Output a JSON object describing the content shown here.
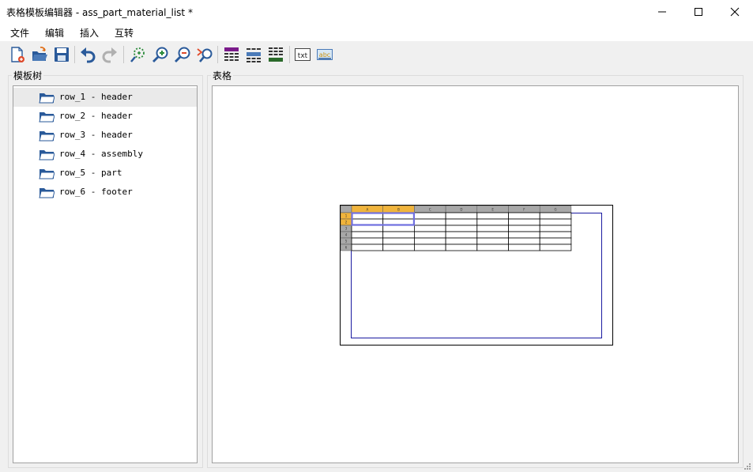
{
  "window": {
    "title": "表格模板编辑器 - ass_part_material_list *",
    "minimize": "—",
    "maximize": "☐",
    "close": "✕"
  },
  "menu": {
    "items": [
      "文件",
      "编辑",
      "插入",
      "互转"
    ]
  },
  "toolbar": {
    "buttons": [
      "new-file-icon",
      "open-folder-icon",
      "save-icon",
      "undo-icon",
      "redo-icon",
      "fit-view-icon",
      "zoom-in-icon",
      "zoom-out-icon",
      "zoom-reset-icon",
      "table-style-1-icon",
      "table-style-2-icon",
      "table-style-3-icon",
      "txt-icon",
      "abc-text-icon"
    ],
    "txt_label": "txt",
    "abc_label": "abc"
  },
  "tree_panel": {
    "title": "模板树",
    "items": [
      {
        "label": "row_1 - header",
        "selected": true
      },
      {
        "label": "row_2 - header",
        "selected": false
      },
      {
        "label": "row_3 - header",
        "selected": false
      },
      {
        "label": "row_4 - assembly",
        "selected": false
      },
      {
        "label": "row_5 - part",
        "selected": false
      },
      {
        "label": "row_6 - footer",
        "selected": false
      }
    ]
  },
  "table_panel": {
    "title": "表格",
    "columns": [
      "A",
      "B",
      "C",
      "D",
      "E",
      "F",
      "G"
    ],
    "rows": [
      "1",
      "2",
      "3",
      "4",
      "5",
      "6"
    ],
    "highlighted_columns": [
      "A",
      "B"
    ],
    "highlighted_rows": [
      "1",
      "2"
    ]
  },
  "colors": {
    "accent_header": "#f0b43c",
    "header_gray": "#a8a8a8",
    "selection_outline": "#7070e0",
    "frame_blue": "#1a1aa0",
    "folder_blue": "#2a5a9a"
  }
}
